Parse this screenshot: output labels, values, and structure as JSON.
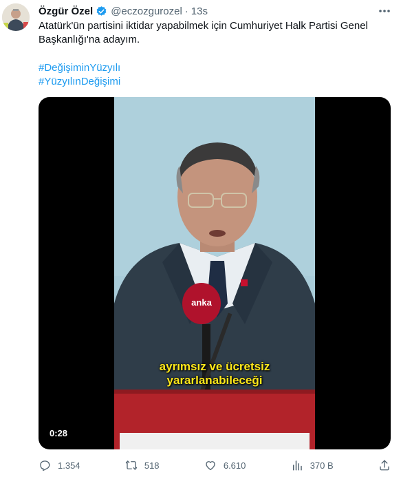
{
  "author": {
    "name": "Özgür Özel",
    "handle": "@eczozgurozel",
    "separator": "·",
    "time": "13s"
  },
  "tweet": {
    "text_line1": "Atatürk'ün partisini iktidar yapabilmek için Cumhuriyet Halk Partisi Genel",
    "text_line2": "Başkanlığı'na adayım.",
    "hashtags": [
      "#DeğişiminYüzyılı",
      "#YüzyılınDeğişimi"
    ]
  },
  "media": {
    "duration": "0:28",
    "subtitle_line1": "ayrımsız ve ücretsiz",
    "subtitle_line2": "yararlanabileceği",
    "mic_brand": "anka"
  },
  "actions": {
    "replies": "1.354",
    "reposts": "518",
    "likes": "6.610",
    "views": "370 B"
  },
  "colors": {
    "accent": "#1d9bf0",
    "muted": "#536471",
    "stage_background": "#a9ccd9",
    "podium": "#b2232a"
  }
}
